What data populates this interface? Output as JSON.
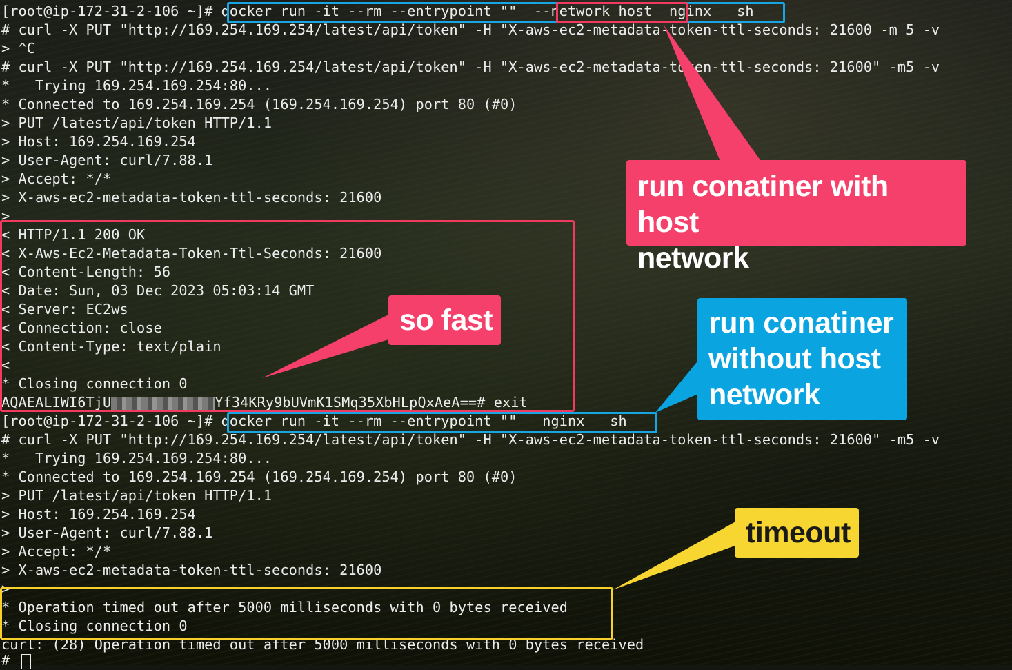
{
  "terminal": {
    "lines": [
      "[root@ip-172-31-2-106 ~]# docker run -it --rm --entrypoint \"\"  --network host  nginx   sh",
      "# curl -X PUT \"http://169.254.169.254/latest/api/token\" -H \"X-aws-ec2-metadata-token-ttl-seconds: 21600 -m 5 -v",
      "> ^C",
      "# curl -X PUT \"http://169.254.169.254/latest/api/token\" -H \"X-aws-ec2-metadata-token-ttl-seconds: 21600\" -m5 -v",
      "*   Trying 169.254.169.254:80...",
      "* Connected to 169.254.169.254 (169.254.169.254) port 80 (#0)",
      "> PUT /latest/api/token HTTP/1.1",
      "> Host: 169.254.169.254",
      "> User-Agent: curl/7.88.1",
      "> Accept: */*",
      "> X-aws-ec2-metadata-token-ttl-seconds: 21600",
      ">",
      "< HTTP/1.1 200 OK",
      "< X-Aws-Ec2-Metadata-Token-Ttl-Seconds: 21600",
      "< Content-Length: 56",
      "< Date: Sun, 03 Dec 2023 05:03:14 GMT",
      "< Server: EC2ws",
      "< Connection: close",
      "< Content-Type: text/plain",
      "<",
      "* Closing connection 0"
    ],
    "token_line_prefix": "AQAEALIWI6TjU",
    "token_line_suffix": "Yf34KRy9bUVmK1SMq35XbHLpQxAeA==# exit",
    "lines2": [
      "[root@ip-172-31-2-106 ~]# docker run -it --rm --entrypoint \"\"   nginx   sh",
      "# curl -X PUT \"http://169.254.169.254/latest/api/token\" -H \"X-aws-ec2-metadata-token-ttl-seconds: 21600\" -m5 -v",
      "*   Trying 169.254.169.254:80...",
      "* Connected to 169.254.169.254 (169.254.169.254) port 80 (#0)",
      "> PUT /latest/api/token HTTP/1.1",
      "> Host: 169.254.169.254",
      "> User-Agent: curl/7.88.1",
      "> Accept: */*",
      "> X-aws-ec2-metadata-token-ttl-seconds: 21600",
      ">",
      "* Operation timed out after 5000 milliseconds with 0 bytes received",
      "* Closing connection 0",
      "curl: (28) Operation timed out after 5000 milliseconds with 0 bytes received"
    ],
    "prompt_last": "# "
  },
  "annotations": {
    "host_network": "run conatiner with host\nnetwork",
    "so_fast": "so fast",
    "without_host": "run conatiner\nwithout host\nnetwork",
    "timeout": "timeout"
  },
  "colors": {
    "red": "#f4406a",
    "blue": "#0aa4e0",
    "yellow": "#f7d631",
    "text": "#ececec"
  }
}
